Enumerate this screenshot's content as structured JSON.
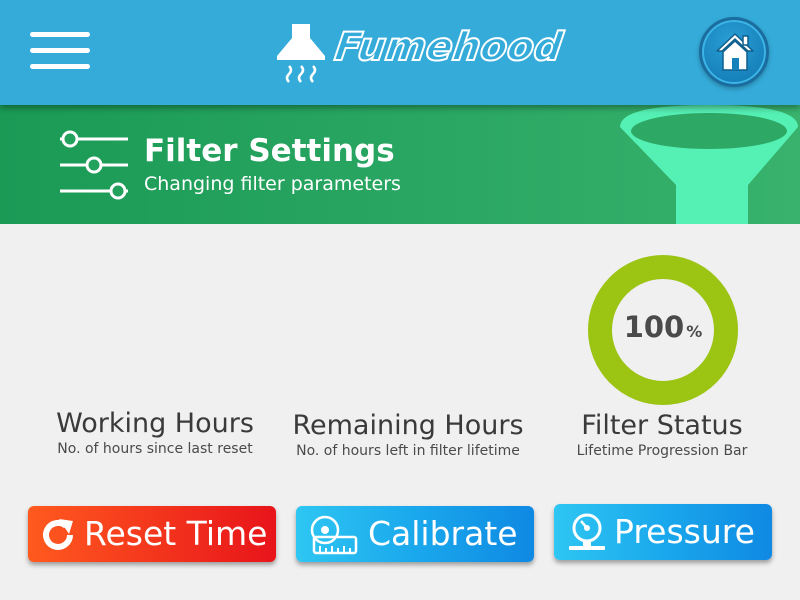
{
  "header": {
    "brand": "Fumehood",
    "menu_icon": "hamburger-menu-icon",
    "logo_icon": "fume-hood-icon",
    "home_icon": "home-icon",
    "background_color": "#35abd9"
  },
  "banner": {
    "title": "Filter Settings",
    "subtitle": "Changing filter parameters",
    "icon": "sliders-icon",
    "decoration_icon": "funnel-icon",
    "background_color": "#2aa763"
  },
  "stats": {
    "working": {
      "title": "Working Hours",
      "subtitle": "No. of hours since last reset"
    },
    "remaining": {
      "title": "Remaining Hours",
      "subtitle": "No. of hours left in filter lifetime"
    },
    "filter": {
      "title": "Filter Status",
      "subtitle": "Lifetime Progression Bar",
      "value": "100",
      "unit": "%",
      "progress_fraction": 1.0,
      "ring_color": "#9cc412"
    }
  },
  "buttons": {
    "reset": {
      "label": "Reset Time",
      "icon": "refresh-icon",
      "color": "#f53a1d"
    },
    "calibrate": {
      "label": "Calibrate",
      "icon": "tape-measure-icon",
      "color": "#1aa8ec"
    },
    "pressure": {
      "label": "Pressure",
      "icon": "pressure-gauge-icon",
      "color": "#1aa8ec"
    }
  }
}
